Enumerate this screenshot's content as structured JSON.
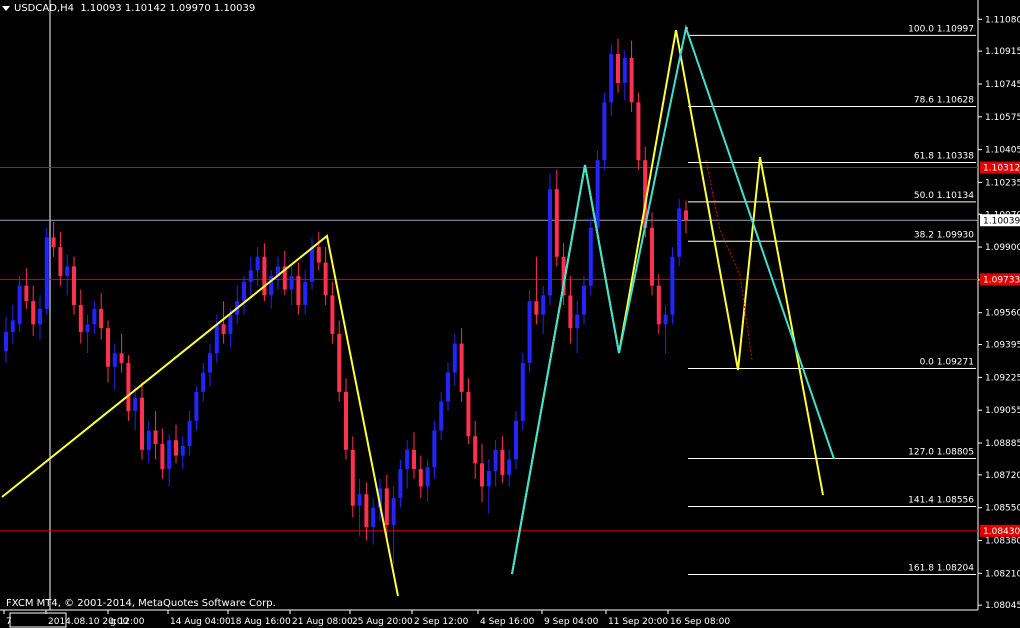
{
  "header": {
    "symbol": "USDCAD,H4",
    "ohlc": "1.10093 1.10142 1.09970 1.10039"
  },
  "footer": {
    "copyright": "FXCM MT4, © 2001-2014, MetaQuotes Software Corp."
  },
  "chart_data": {
    "type": "candlestick",
    "ylim": [
      1.0802,
      1.1118
    ],
    "y_ticks": [
      "1.11080",
      "1.10915",
      "1.10745",
      "1.10575",
      "1.10405",
      "1.10235",
      "1.10070",
      "1.09900",
      "1.09730",
      "1.09560",
      "1.09395",
      "1.09225",
      "1.09055",
      "1.08885",
      "1.08720",
      "1.08550",
      "1.08380",
      "1.08210",
      "1.08045"
    ],
    "x_labels": [
      "7",
      "2014.08.10 20:00",
      "g 12:00",
      "14 Aug 04:00",
      "18 Aug 16:00",
      "21 Aug 08:00",
      "25 Aug 20:00",
      "2 Sep 12:00",
      "4 Sep 16:00",
      "9 Sep 04:00",
      "11 Sep 20:00",
      "16 Sep 08:00"
    ],
    "price_labels": [
      {
        "text": "1.10312",
        "value": 1.10312,
        "bg": "#e00000"
      },
      {
        "text": "1.10039",
        "value": 1.10039,
        "bg": "#ffffff"
      },
      {
        "text": "1.09733",
        "value": 1.09733,
        "bg": "#e00000"
      },
      {
        "text": "1.08430",
        "value": 1.0843,
        "bg": "#e00000"
      }
    ],
    "horizontal_lines": [
      {
        "value": 1.10312,
        "color": "#e00000"
      },
      {
        "value": 1.10039,
        "color": "#8fa8c8"
      },
      {
        "value": 1.09733,
        "color": "#e00000"
      },
      {
        "value": 1.0843,
        "color": "#e00000"
      }
    ],
    "fib_levels": [
      {
        "label": "100.0 1.10997",
        "value": 1.10997
      },
      {
        "label": "78.6 1.10628",
        "value": 1.10628
      },
      {
        "label": "61.8 1.10338",
        "value": 1.10338
      },
      {
        "label": "50.0 1.10134",
        "value": 1.10134
      },
      {
        "label": "38.2 1.09930",
        "value": 1.0993
      },
      {
        "label": "0.0 1.09271",
        "value": 1.09271
      },
      {
        "label": "127.0 1.08805",
        "value": 1.08805
      },
      {
        "label": "141.4 1.08556",
        "value": 1.08556
      },
      {
        "label": "161.8 1.08204",
        "value": 1.08204
      }
    ],
    "series": [
      {
        "color": "#2424ff",
        "up": true,
        "values": [
          [
            1.0936,
            1.0954,
            1.093,
            1.0946
          ],
          [
            1.0946,
            1.096,
            1.094,
            1.0952
          ],
          [
            1.095,
            1.0975,
            1.0946,
            1.097
          ],
          [
            1.097,
            1.0979,
            1.0958,
            1.0962
          ],
          [
            1.0962,
            1.097,
            1.0944,
            1.095
          ],
          [
            1.095,
            1.0965,
            1.0942,
            1.0958
          ],
          [
            1.0958,
            1.1,
            1.0955,
            1.0995
          ],
          [
            1.0995,
            1.1003,
            1.0985,
            1.099
          ],
          [
            1.099,
            1.0998,
            1.097,
            1.0975
          ],
          [
            1.0975,
            1.0986,
            1.0965,
            1.098
          ],
          [
            1.098,
            1.0985,
            1.0955,
            1.096
          ],
          [
            1.096,
            1.0968,
            1.094,
            1.0946
          ],
          [
            1.0946,
            1.0955,
            1.0935,
            1.095
          ],
          [
            1.095,
            1.0962,
            1.0945,
            1.0958
          ],
          [
            1.0958,
            1.0966,
            1.0942,
            1.0948
          ],
          [
            1.0948,
            1.0952,
            1.092,
            1.0928
          ],
          [
            1.0928,
            1.094,
            1.0916,
            1.0935
          ],
          [
            1.0935,
            1.0945,
            1.0925,
            1.093
          ],
          [
            1.093,
            1.0934,
            1.09,
            1.0905
          ],
          [
            1.0905,
            1.0918,
            1.0895,
            1.0912
          ],
          [
            1.0912,
            1.092,
            1.088,
            1.0885
          ],
          [
            1.0885,
            1.09,
            1.0878,
            1.0895
          ],
          [
            1.0895,
            1.0905,
            1.088,
            1.0888
          ],
          [
            1.0888,
            1.0896,
            1.087,
            1.0875
          ],
          [
            1.0875,
            1.0893,
            1.0866,
            1.089
          ],
          [
            1.089,
            1.0898,
            1.0878,
            1.0882
          ],
          [
            1.0882,
            1.0892,
            1.0875,
            1.0887
          ],
          [
            1.0887,
            1.0905,
            1.0882,
            1.09
          ],
          [
            1.09,
            1.0918,
            1.0895,
            1.0915
          ],
          [
            1.0915,
            1.093,
            1.091,
            1.0925
          ],
          [
            1.0925,
            1.094,
            1.0918,
            1.0935
          ],
          [
            1.0935,
            1.0955,
            1.093,
            1.095
          ],
          [
            1.095,
            1.0962,
            1.094,
            1.0945
          ],
          [
            1.0945,
            1.0958,
            1.0938,
            1.0955
          ],
          [
            1.0955,
            1.097,
            1.095,
            1.0962
          ],
          [
            1.0962,
            1.0975,
            1.0955,
            1.0972
          ],
          [
            1.0972,
            1.0985,
            1.0965,
            1.0978
          ],
          [
            1.0978,
            1.099,
            1.097,
            1.0985
          ],
          [
            1.0985,
            1.0992,
            1.0962,
            1.0965
          ],
          [
            1.0965,
            1.0978,
            1.0958,
            1.0975
          ],
          [
            1.0975,
            1.0985,
            1.0968,
            1.098
          ],
          [
            1.098,
            1.0988,
            1.0965,
            1.0968
          ],
          [
            1.0968,
            1.098,
            1.096,
            1.0975
          ],
          [
            1.0975,
            1.0982,
            1.0955,
            1.096
          ],
          [
            1.096,
            1.0978,
            1.0955,
            1.0972
          ],
          [
            1.0972,
            1.0995,
            1.0968,
            1.099
          ],
          [
            1.099,
            1.0998,
            1.0978,
            1.0982
          ],
          [
            1.0982,
            1.099,
            1.096,
            1.0965
          ],
          [
            1.0965,
            1.0972,
            1.094,
            1.0945
          ],
          [
            1.0945,
            1.0952,
            1.091,
            1.0915
          ],
          [
            1.0915,
            1.0922,
            1.088,
            1.0885
          ],
          [
            1.0885,
            1.0892,
            1.085,
            1.0856
          ],
          [
            1.0856,
            1.087,
            1.084,
            1.0862
          ],
          [
            1.0862,
            1.0868,
            1.0838,
            1.0845
          ],
          [
            1.0845,
            1.086,
            1.0836,
            1.0855
          ],
          [
            1.0855,
            1.087,
            1.0848,
            1.0865
          ],
          [
            1.0865,
            1.0872,
            1.084,
            1.0846
          ],
          [
            1.0846,
            1.0866,
            1.0826,
            1.086
          ],
          [
            1.086,
            1.088,
            1.0855,
            1.0875
          ],
          [
            1.0875,
            1.089,
            1.0865,
            1.0885
          ],
          [
            1.0885,
            1.0894,
            1.087,
            1.0875
          ],
          [
            1.0875,
            1.0882,
            1.086,
            1.0866
          ],
          [
            1.0866,
            1.088,
            1.0858,
            1.0876
          ],
          [
            1.0876,
            1.09,
            1.087,
            1.0895
          ],
          [
            1.0895,
            1.0915,
            1.089,
            1.091
          ],
          [
            1.091,
            1.093,
            1.0905,
            1.0925
          ],
          [
            1.0925,
            1.0945,
            1.0918,
            1.094
          ],
          [
            1.094,
            1.0948,
            1.091,
            1.0915
          ],
          [
            1.0915,
            1.0922,
            1.0888,
            1.0892
          ],
          [
            1.0892,
            1.09,
            1.087,
            1.0878
          ],
          [
            1.0878,
            1.0888,
            1.0858,
            1.0866
          ],
          [
            1.0866,
            1.088,
            1.0852,
            1.0874
          ],
          [
            1.0874,
            1.089,
            1.0866,
            1.0885
          ],
          [
            1.0885,
            1.0892,
            1.0868,
            1.0872
          ],
          [
            1.0872,
            1.0885,
            1.0866,
            1.088
          ],
          [
            1.088,
            1.0905,
            1.0875,
            1.09
          ],
          [
            1.09,
            1.0935,
            1.0895,
            1.093
          ],
          [
            1.093,
            1.0968,
            1.0925,
            1.0962
          ],
          [
            1.0962,
            1.0985,
            1.095,
            1.0955
          ],
          [
            1.0955,
            1.097,
            1.0945,
            1.0965
          ],
          [
            1.0965,
            1.1028,
            1.096,
            1.102
          ],
          [
            1.102,
            1.103,
            1.098,
            1.0985
          ],
          [
            1.0985,
            1.0992,
            1.096,
            1.0965
          ],
          [
            1.0965,
            1.0975,
            1.094,
            1.0948
          ],
          [
            1.0948,
            1.0962,
            1.0935,
            1.0955
          ],
          [
            1.0955,
            1.0975,
            1.095,
            1.097
          ],
          [
            1.097,
            1.1005,
            1.0965,
            1.1
          ],
          [
            1.1,
            1.104,
            1.0995,
            1.1035
          ],
          [
            1.1035,
            1.107,
            1.103,
            1.1065
          ],
          [
            1.1065,
            1.1095,
            1.1058,
            1.109
          ],
          [
            1.109,
            1.1098,
            1.107,
            1.1075
          ],
          [
            1.1075,
            1.1092,
            1.1066,
            1.1088
          ],
          [
            1.1088,
            1.1097,
            1.106,
            1.1065
          ],
          [
            1.1065,
            1.107,
            1.103,
            1.1035
          ],
          [
            1.1035,
            1.1042,
            1.0995,
            1.1
          ],
          [
            1.1,
            1.1008,
            1.0965,
            1.097
          ],
          [
            1.097,
            1.0976,
            1.0945,
            1.095
          ],
          [
            1.095,
            1.096,
            1.0935,
            1.0955
          ],
          [
            1.0955,
            1.099,
            1.095,
            1.0985
          ],
          [
            1.0985,
            1.1015,
            1.098,
            1.101
          ],
          [
            1.1009,
            1.1014,
            1.0997,
            1.1004
          ]
        ]
      }
    ]
  }
}
